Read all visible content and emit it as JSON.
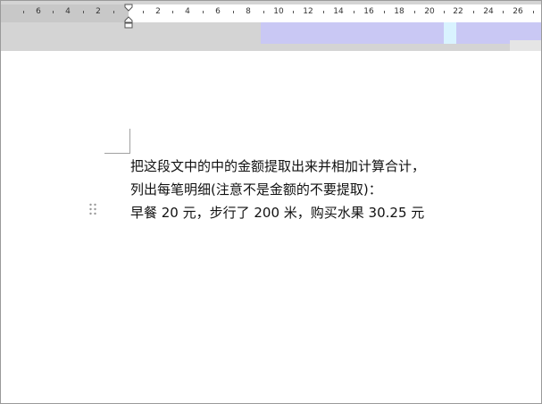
{
  "ruler": {
    "left_labels": [
      "6",
      "4",
      "2"
    ],
    "right_labels": [
      "2",
      "4",
      "6",
      "8",
      "10",
      "12",
      "14",
      "16",
      "18",
      "20",
      "22",
      "24",
      "26"
    ]
  },
  "document": {
    "lines": [
      "把这段文中的中的金额提取出来并相加计算合计，",
      "列出每笔明细(注意不是金额的不要提取)：",
      "早餐 20 元，步行了 200 米，购买水果 30.25 元"
    ]
  },
  "icons": {
    "indent_marker": "indent-marker-icon",
    "paragraph_handle": "drag-handle-icon"
  },
  "colors": {
    "ruler_gray": "#c8c8c8",
    "ruler_white": "#ffffff",
    "artifact_blue": "#c9c8f4"
  }
}
